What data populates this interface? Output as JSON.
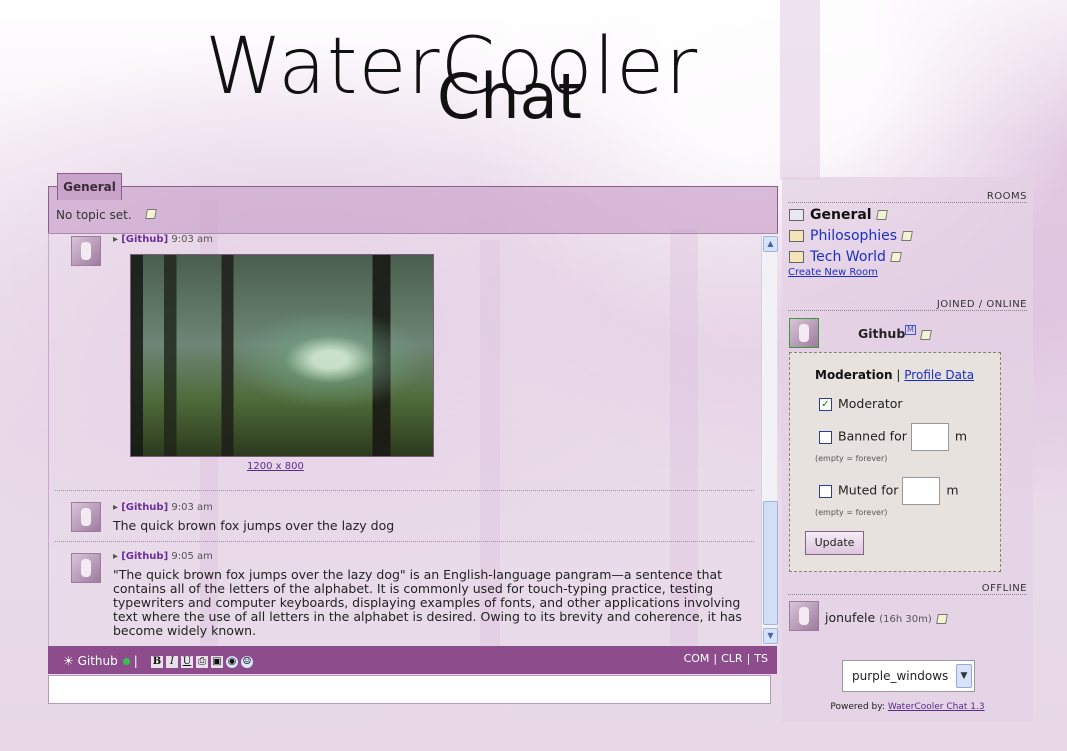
{
  "logo": {
    "line1": "WaterCooler",
    "line2": "Chat"
  },
  "room": {
    "tab_label": "General",
    "topic": "No topic set."
  },
  "messages": [
    {
      "user": "[Github]",
      "time": "9:03 am",
      "image_caption": "1200 x 800"
    },
    {
      "user": "[Github]",
      "time": "9:03 am",
      "text": "The quick brown fox jumps over the lazy dog"
    },
    {
      "user": "[Github]",
      "time": "9:05 am",
      "text": "\"The quick brown fox jumps over the lazy dog\" is an English-language pangram—a sentence that contains all of the letters of the alphabet. It is commonly used for touch-typing practice, testing typewriters and computer keyboards, displaying examples of fonts, and other applications involving text where the use of all letters in the alphabet is desired. Owing to its brevity and coherence, it has become widely known."
    }
  ],
  "toolbar": {
    "current_user": "Github",
    "separator": "|",
    "bold": "B",
    "italic": "I",
    "underline": "U",
    "right": [
      "COM",
      "CLR",
      "TS"
    ]
  },
  "sidebar": {
    "rooms_heading": "ROOMS",
    "rooms": [
      {
        "name": "General",
        "current": true
      },
      {
        "name": "Philosophies",
        "current": false
      },
      {
        "name": "Tech World",
        "current": false
      }
    ],
    "create_room": "Create New Room",
    "online_heading": "JOINED / ONLINE",
    "online_user": "Github",
    "mod_badge": "M",
    "moderation": {
      "title": "Moderation",
      "separator": "|",
      "profile_link": "Profile Data",
      "moderator_label": "Moderator",
      "moderator_checked": true,
      "banned_label": "Banned for",
      "muted_label": "Muted for",
      "unit": "m",
      "hint": "(empty = forever)",
      "update_button": "Update"
    },
    "offline_heading": "OFFLINE",
    "offline_user": "jonufele",
    "offline_time": "(16h 30m)",
    "theme": "purple_windows",
    "powered_by": "Powered by:",
    "powered_link": "WaterCooler Chat 1.3"
  },
  "colors": {
    "toolbar": "#8d4d8d",
    "accent": "#c9a3c9",
    "link": "#1a2fc4",
    "status_online": "#37c24a"
  }
}
